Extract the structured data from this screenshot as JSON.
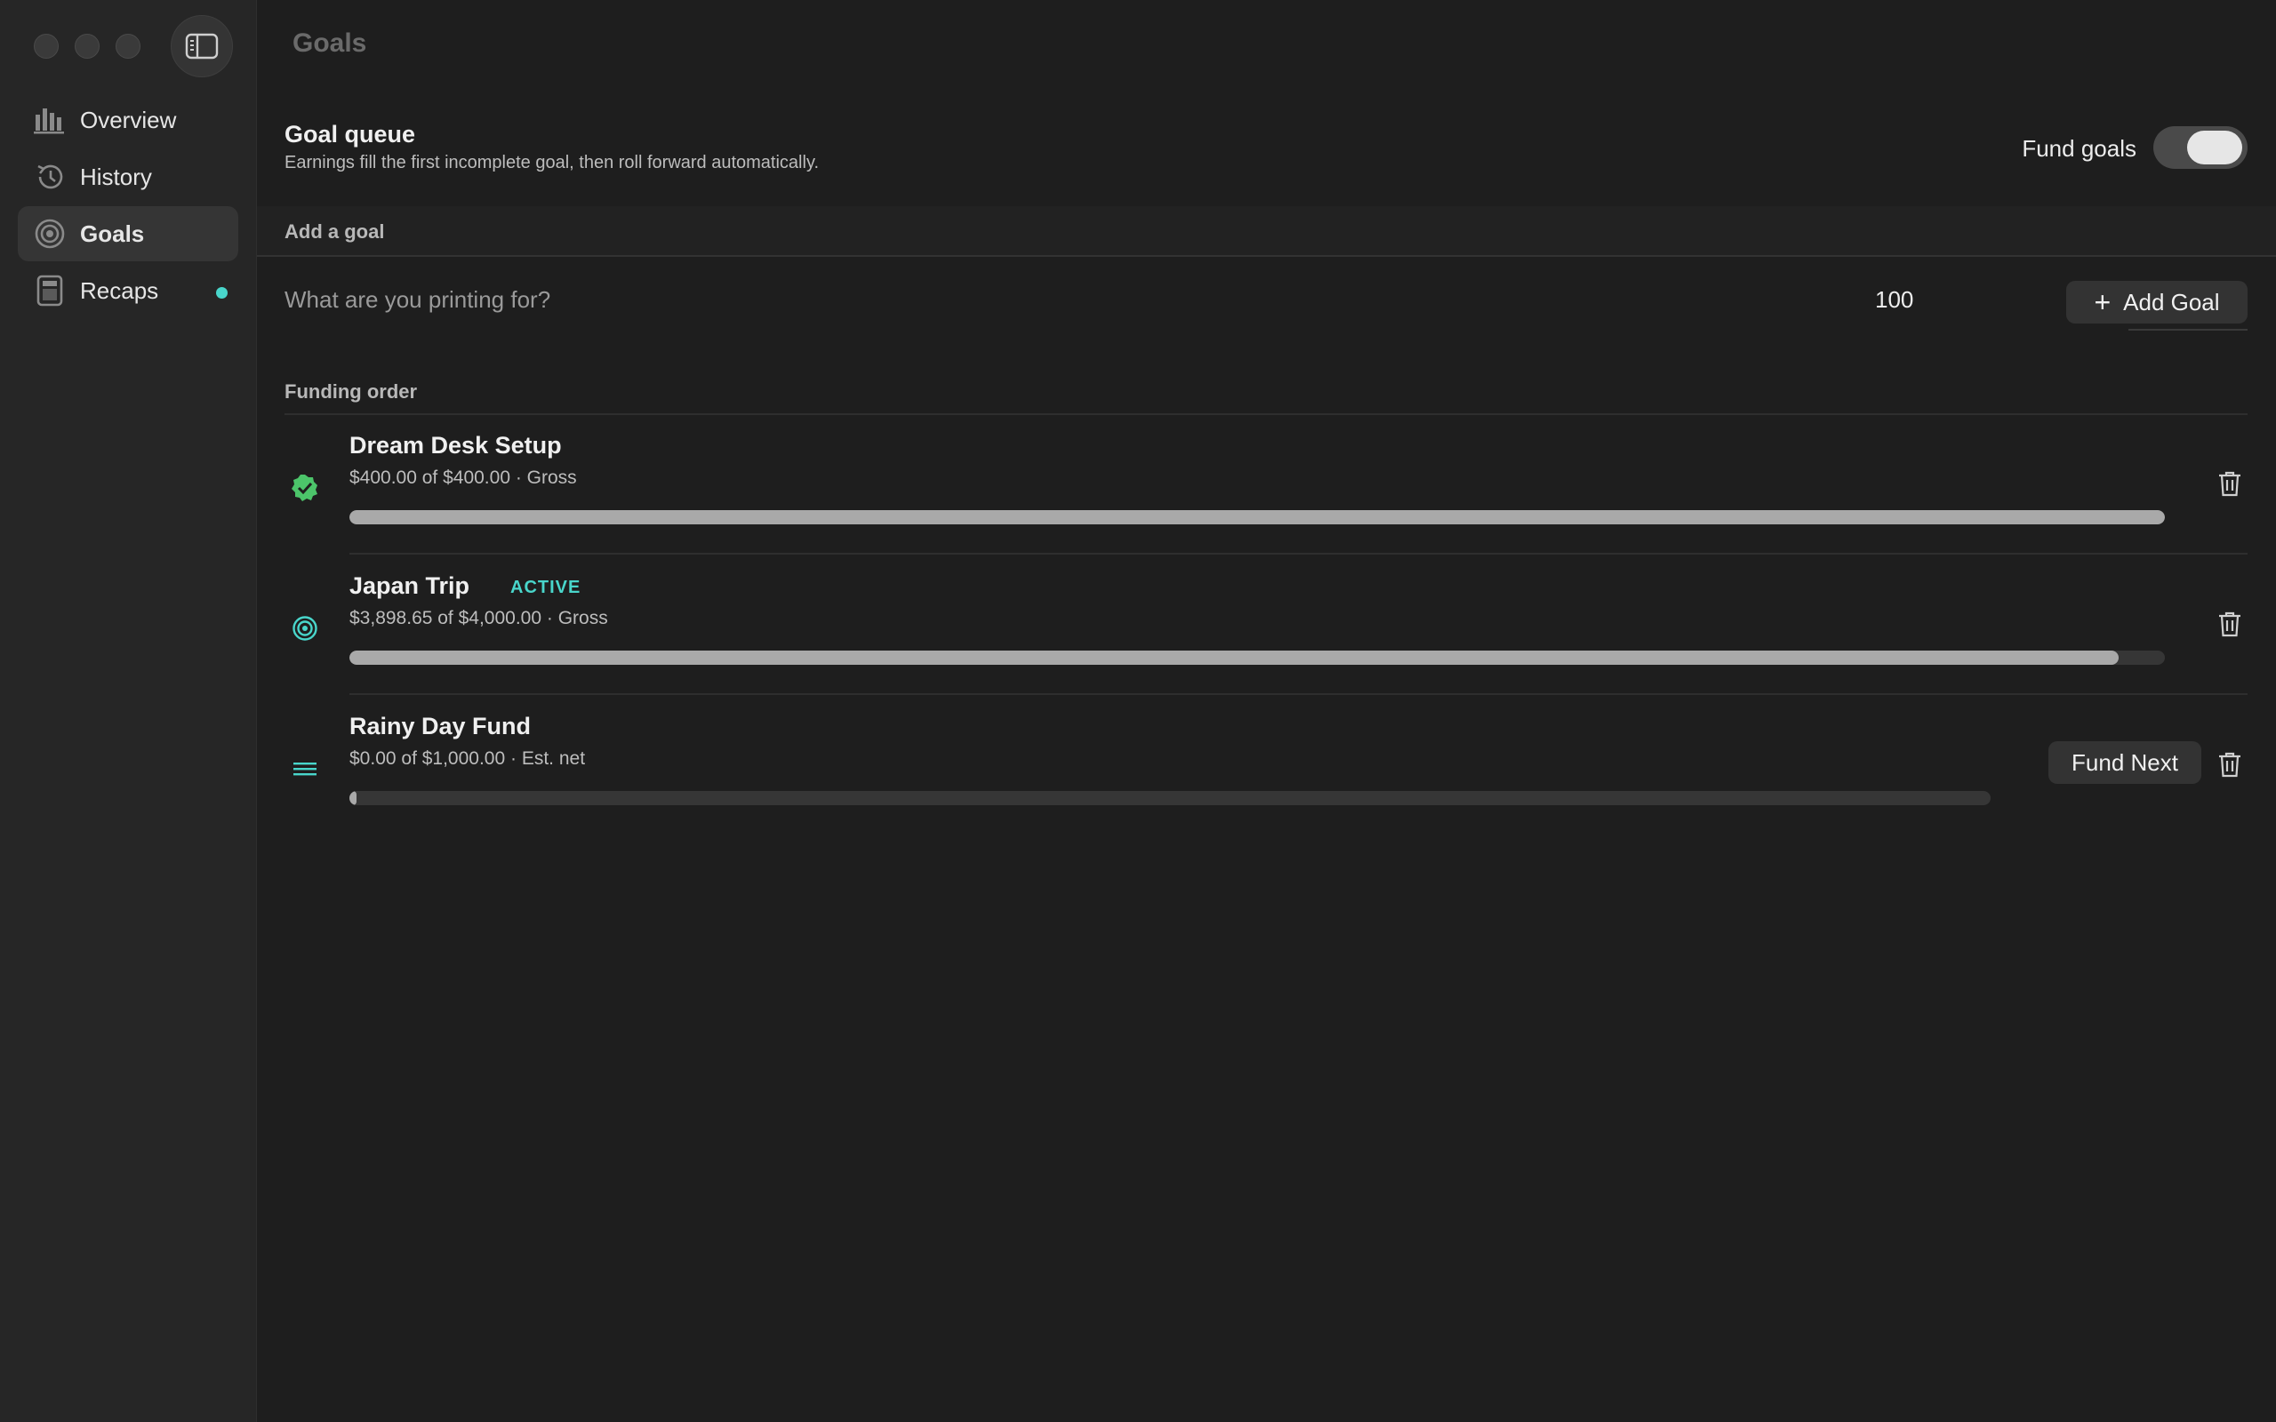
{
  "window": {
    "title": "Goals"
  },
  "sidebar": {
    "items": [
      {
        "label": "Overview",
        "icon": "bar-chart-icon",
        "selected": false
      },
      {
        "label": "History",
        "icon": "history-clock-icon",
        "selected": false
      },
      {
        "label": "Goals",
        "icon": "target-icon",
        "selected": true
      },
      {
        "label": "Recaps",
        "icon": "recap-document-icon",
        "selected": false,
        "has_dot": true
      }
    ]
  },
  "goal_queue": {
    "title": "Goal queue",
    "subtitle": "Earnings fill the first incomplete goal, then roll forward automatically.",
    "fund_goals_label": "Fund goals",
    "fund_goals_on": true
  },
  "add_goal": {
    "section_label": "Add a goal",
    "name_placeholder": "What are you printing for?",
    "amount_value": "100",
    "add_button_label": "Add Goal"
  },
  "funding_order": {
    "label": "Funding order",
    "goals": [
      {
        "name": "Dream Desk Setup",
        "meta": "$400.00 of $400.00 · Gross",
        "badge": "",
        "status": "completed",
        "progress": 1.0
      },
      {
        "name": "Japan Trip",
        "meta": "$3,898.65 of $4,000.00 · Gross",
        "badge": "ACTIVE",
        "status": "active",
        "progress": 0.9747
      },
      {
        "name": "Rainy Day Fund",
        "meta": "$0.00 of $1,000.00 · Est. net",
        "badge": "",
        "status": "queued",
        "progress": 0.0,
        "action_label": "Fund Next"
      }
    ]
  },
  "colors": {
    "accent": "#49d6cb",
    "success": "#4cc46a",
    "background": "#1e1e1e",
    "sidebar": "#262626"
  }
}
